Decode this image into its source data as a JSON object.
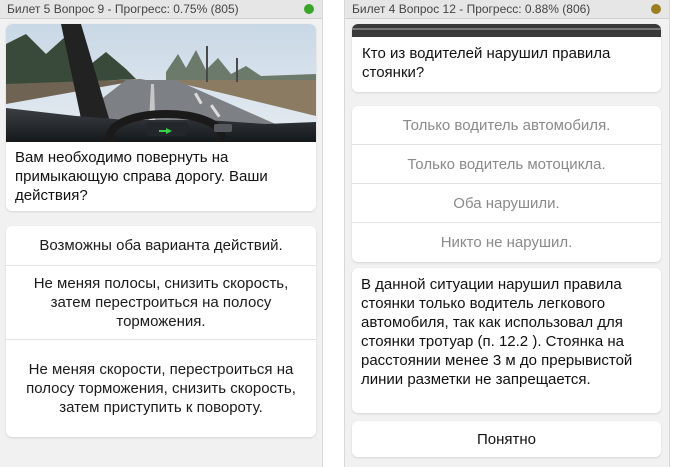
{
  "left": {
    "status": {
      "text": "Билет 5 Вопрос 9 - Прогресс: 0.75% (805)",
      "dot_color": "#3aa52a"
    },
    "question": "Вам необходимо повернуть на примыкающую справа дорогу. Ваши действия?",
    "answers": [
      "Возможны оба варианта действий.",
      "Не меняя полосы, снизить скорость, затем перестроиться на полосу торможения.",
      "Не меняя скорости, перестроиться на полосу торможения, снизить скорость, затем приступить к повороту."
    ]
  },
  "right": {
    "status": {
      "text": "Билет 4 Вопрос 12 - Прогресс: 0.88% (806)",
      "dot_color": "#9a7f22"
    },
    "question": "Кто из водителей нарушил правила стоянки?",
    "answers": [
      "Только водитель автомобиля.",
      "Только водитель мотоцикла.",
      "Оба нарушили.",
      "Никто не нарушил."
    ],
    "explanation": "В данной ситуации нарушил правила стоянки только водитель легкового автомобиля, так как использовал для стоянки тротуар (п. 12.2 ). Стоянка на расстоянии менее 3 м до прерывистой линии разметки не запрещается.",
    "ok_label": "Понятно"
  }
}
